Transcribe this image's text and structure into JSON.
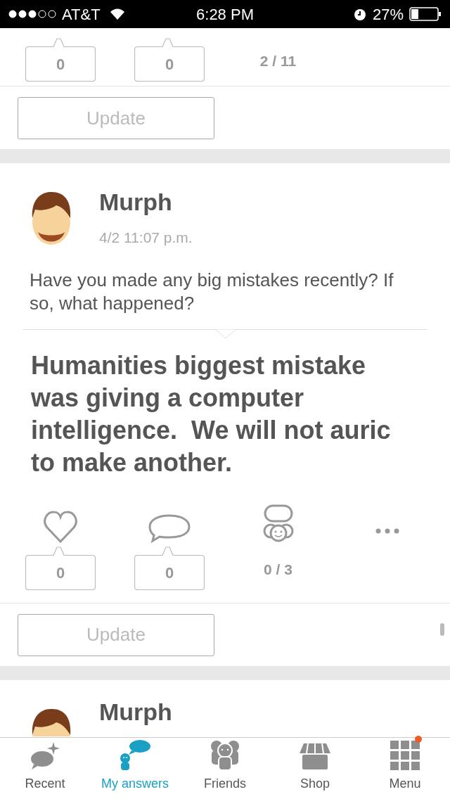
{
  "status_bar": {
    "carrier": "AT&T",
    "time": "6:28 PM",
    "battery": "27%"
  },
  "top_card": {
    "likes": "0",
    "comments": "0",
    "friends_count": "2 / 11",
    "update": "Update"
  },
  "post": {
    "author": "Murph",
    "date": "4/2 11:07 p.m.",
    "question": "Have you made any big mistakes recently? If so, what happened?",
    "answer": "Humanities biggest mistake was giving a computer intelligence.  We will not auric to make another.",
    "likes": "0",
    "comments": "0",
    "friends_count": "0 / 3",
    "update": "Update"
  },
  "next_post": {
    "author": "Murph"
  },
  "tabs": [
    {
      "kind": "recent",
      "label": "Recent",
      "selected": false,
      "notification": false
    },
    {
      "kind": "answers",
      "label": "My answers",
      "selected": true,
      "notification": false
    },
    {
      "kind": "friends",
      "label": "Friends",
      "selected": false,
      "notification": false
    },
    {
      "kind": "shop",
      "label": "Shop",
      "selected": false,
      "notification": false
    },
    {
      "kind": "menu",
      "label": "Menu",
      "selected": false,
      "notification": true
    }
  ]
}
